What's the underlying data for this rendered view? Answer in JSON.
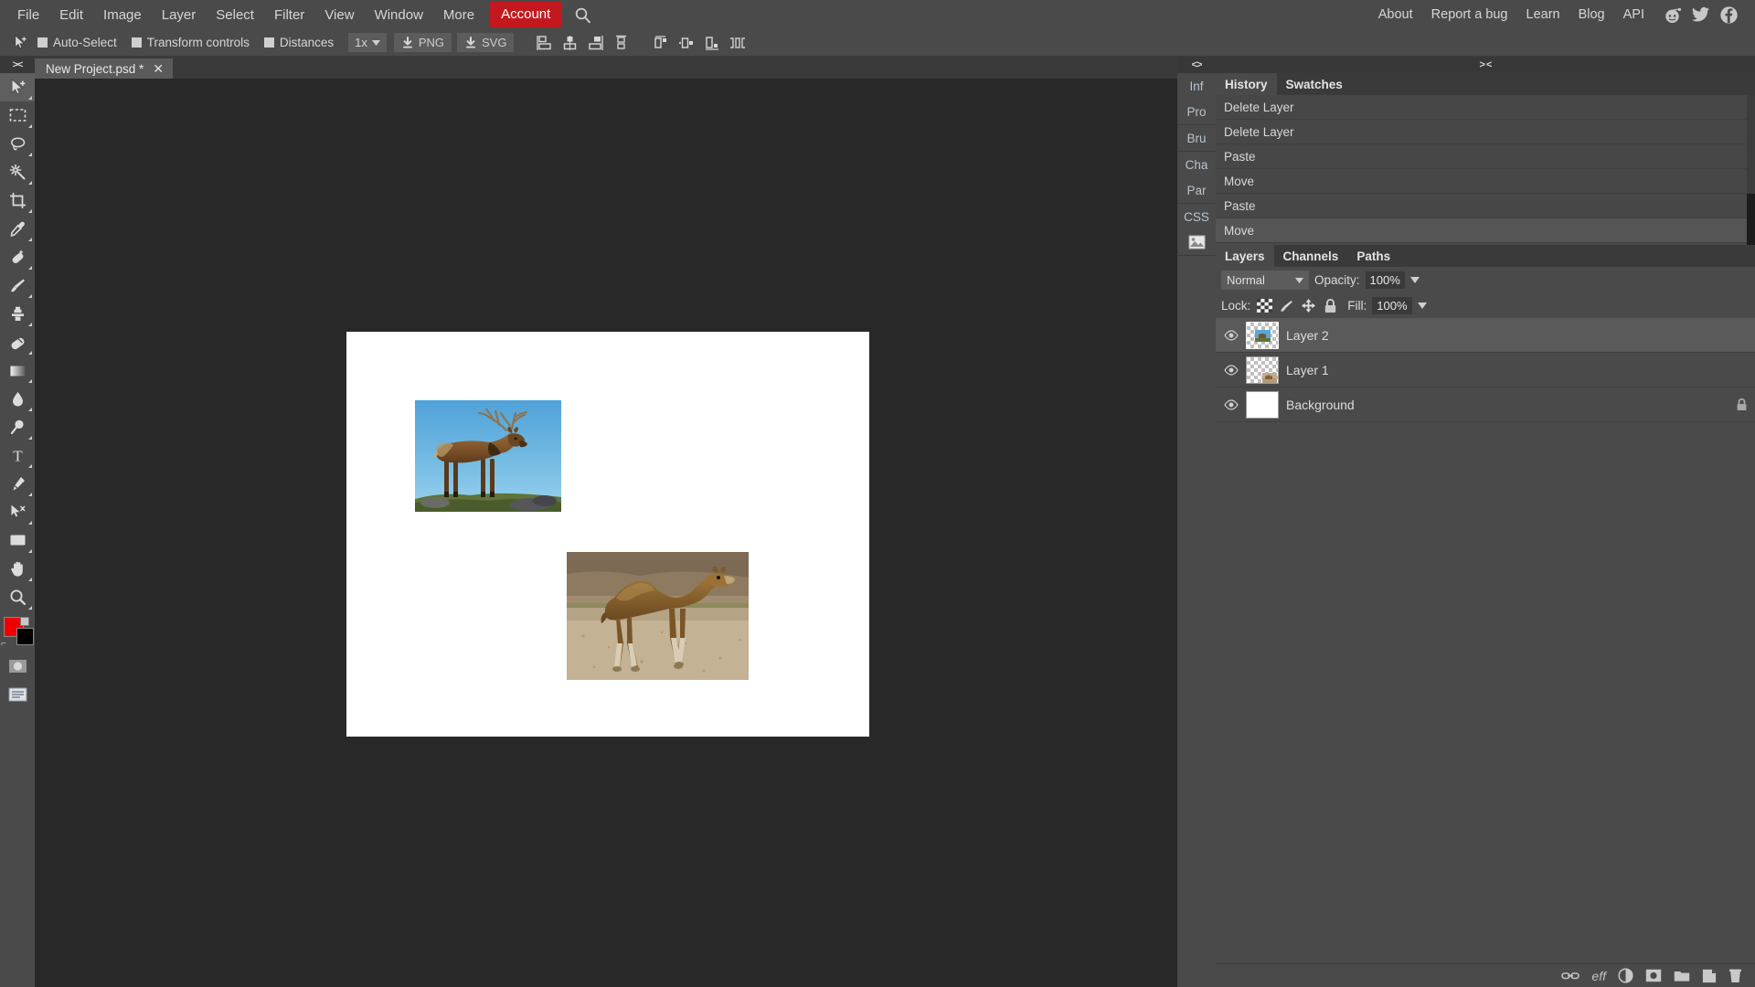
{
  "menubar": {
    "left_items": [
      {
        "label": "File"
      },
      {
        "label": "Edit"
      },
      {
        "label": "Image"
      },
      {
        "label": "Layer"
      },
      {
        "label": "Select"
      },
      {
        "label": "Filter"
      },
      {
        "label": "View"
      },
      {
        "label": "Window"
      },
      {
        "label": "More"
      }
    ],
    "account_label": "Account",
    "search_icon": "search-icon",
    "right_items": [
      {
        "label": "About"
      },
      {
        "label": "Report a bug"
      },
      {
        "label": "Learn"
      },
      {
        "label": "Blog"
      },
      {
        "label": "API"
      }
    ],
    "social": [
      {
        "name": "reddit-icon"
      },
      {
        "name": "twitter-icon"
      },
      {
        "name": "facebook-icon"
      }
    ],
    "accent_color": "#c4181f",
    "bar_color": "#4a4a4a"
  },
  "options_bar": {
    "active_tool_icon": "move-tool-icon",
    "checkboxes": [
      {
        "label": "Auto-Select",
        "checked": true
      },
      {
        "label": "Transform controls",
        "checked": true
      },
      {
        "label": "Distances",
        "checked": true
      }
    ],
    "zoom_select": "1x",
    "export_png": "PNG",
    "export_svg": "SVG",
    "align_buttons": [
      {
        "name": "align-left-edges"
      },
      {
        "name": "align-horizontal-centers"
      },
      {
        "name": "align-right-edges"
      },
      {
        "name": "align-top-edges"
      },
      {
        "name": "distribute-vertical-top"
      },
      {
        "name": "distribute-vertical-center"
      },
      {
        "name": "distribute-vertical-bottom"
      },
      {
        "name": "distribute-horizontal-spacing"
      }
    ]
  },
  "toolbar": {
    "collapse_label": "><",
    "tools": [
      {
        "name": "move-tool",
        "active": true
      },
      {
        "name": "rectangular-marquee-tool",
        "active": false
      },
      {
        "name": "lasso-tool",
        "active": false
      },
      {
        "name": "magic-wand-tool",
        "active": false
      },
      {
        "name": "crop-tool",
        "active": false
      },
      {
        "name": "eyedropper-tool",
        "active": false
      },
      {
        "name": "healing-brush-tool",
        "active": false
      },
      {
        "name": "brush-tool",
        "active": false
      },
      {
        "name": "clone-stamp-tool",
        "active": false
      },
      {
        "name": "eraser-tool",
        "active": false
      },
      {
        "name": "gradient-tool",
        "active": false
      },
      {
        "name": "blur-tool",
        "active": false
      },
      {
        "name": "dodge-tool",
        "active": false
      },
      {
        "name": "type-tool",
        "active": false
      },
      {
        "name": "pen-tool",
        "active": false
      },
      {
        "name": "path-selection-tool",
        "active": false
      },
      {
        "name": "shape-tool",
        "active": false
      },
      {
        "name": "hand-tool",
        "active": false
      },
      {
        "name": "zoom-tool",
        "active": false
      }
    ],
    "foreground_color": "#ee0000",
    "background_color": "#000000",
    "quick_mask": "quick-mask-toggle",
    "screen_mode": "screen-mode-toggle"
  },
  "document": {
    "tab_title": "New Project.psd *",
    "close_label": "✕",
    "canvas_background": "#ffffff",
    "placed_images": [
      {
        "name": "elk-image-layer",
        "alt": "Elk standing on grassy ridge with blue sky"
      },
      {
        "name": "camel-image-layer",
        "alt": "Camel walking in desert landscape"
      }
    ]
  },
  "mini_dock": {
    "collapse_label": "<>",
    "tabs": [
      {
        "label": "Inf",
        "name": "info-panel-tab"
      },
      {
        "label": "Pro",
        "name": "properties-panel-tab"
      },
      {
        "label": "Bru",
        "name": "brushes-panel-tab"
      },
      {
        "label": "Cha",
        "name": "character-panel-tab"
      },
      {
        "label": "Par",
        "name": "paragraph-panel-tab"
      },
      {
        "label": "CSS",
        "name": "css-panel-tab"
      },
      {
        "label": "",
        "name": "image-panel-tab"
      }
    ]
  },
  "history_panel": {
    "collapse_label": "> <",
    "tabs": [
      {
        "label": "History",
        "active": true
      },
      {
        "label": "Swatches",
        "active": false
      }
    ],
    "items": [
      {
        "label": "Delete Layer",
        "selected": false
      },
      {
        "label": "Delete Layer",
        "selected": false
      },
      {
        "label": "Paste",
        "selected": false
      },
      {
        "label": "Move",
        "selected": false
      },
      {
        "label": "Paste",
        "selected": false
      },
      {
        "label": "Move",
        "selected": true
      }
    ]
  },
  "layers_panel": {
    "tabs": [
      {
        "label": "Layers",
        "active": true
      },
      {
        "label": "Channels",
        "active": false
      },
      {
        "label": "Paths",
        "active": false
      }
    ],
    "blend_mode": "Normal",
    "opacity_label": "Opacity:",
    "opacity_value": "100%",
    "lock_label": "Lock:",
    "fill_label": "Fill:",
    "fill_value": "100%",
    "lock_icons": [
      {
        "name": "lock-transparent-pixels-icon"
      },
      {
        "name": "lock-image-pixels-icon"
      },
      {
        "name": "lock-position-icon"
      },
      {
        "name": "lock-all-icon"
      }
    ],
    "layers": [
      {
        "name": "Layer 2",
        "visible": true,
        "selected": true,
        "locked": false,
        "thumb": "elk"
      },
      {
        "name": "Layer 1",
        "visible": true,
        "selected": false,
        "locked": false,
        "thumb": "camel"
      },
      {
        "name": "Background",
        "visible": true,
        "selected": false,
        "locked": true,
        "thumb": "white"
      }
    ],
    "bottom_buttons": [
      {
        "name": "link-layers-button",
        "label": ""
      },
      {
        "name": "layer-effects-button",
        "label": "eff"
      },
      {
        "name": "adjustment-layer-button",
        "label": ""
      },
      {
        "name": "layer-mask-button",
        "label": ""
      },
      {
        "name": "new-group-button",
        "label": ""
      },
      {
        "name": "new-layer-button",
        "label": ""
      },
      {
        "name": "delete-layer-button",
        "label": ""
      }
    ]
  }
}
